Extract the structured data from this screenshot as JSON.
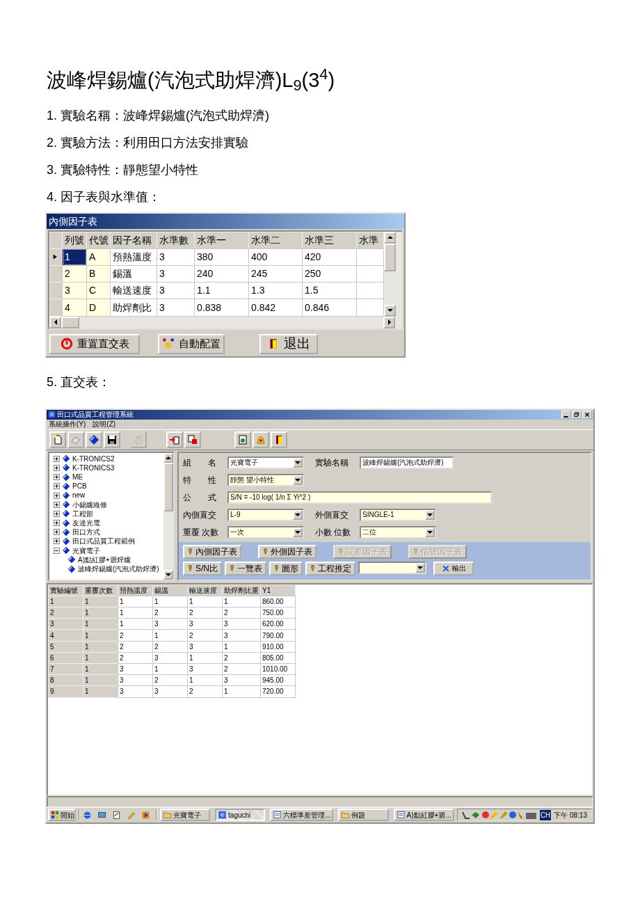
{
  "document": {
    "title": "波峰焊錫爐(汽泡式助焊濟)L$_{9}$(3$^{4}$)",
    "steps": [
      "1. 實驗名稱：波峰焊錫爐(汽泡式助焊濟)",
      "2. 實驗方法：利用田口方法安排實驗",
      "3. 實驗特性：靜態望小特性",
      "4. 因子表與水準值："
    ],
    "step_5": "5. 直交表："
  },
  "factor_dialog": {
    "title": "內側因子表",
    "columns": [
      "列號",
      "代號",
      "因子名稱",
      "水準數",
      "水準一",
      "水準二",
      "水準三",
      "水準"
    ],
    "rows": [
      {
        "selected": true,
        "cells": [
          "1",
          "A",
          "預熱溫度",
          "3",
          "380",
          "400",
          "420",
          ""
        ]
      },
      {
        "selected": false,
        "cells": [
          "2",
          "B",
          "錫溫",
          "3",
          "240",
          "245",
          "250",
          ""
        ]
      },
      {
        "selected": false,
        "cells": [
          "3",
          "C",
          "輸送速度",
          "3",
          "1.1",
          "1.3",
          "1.5",
          ""
        ]
      },
      {
        "selected": false,
        "cells": [
          "4",
          "D",
          "助焊劑比",
          "3",
          "0.838",
          "0.842",
          "0.846",
          ""
        ]
      }
    ],
    "buttons": [
      {
        "kind": "reset",
        "label": "重置直交表"
      },
      {
        "kind": "auto",
        "label": "自動配置"
      },
      {
        "kind": "exit",
        "label": "退出"
      }
    ]
  },
  "app_window": {
    "title": "田口式品質工程管理系統",
    "menu": [
      "系統操作(Y)",
      "說明(Z)"
    ],
    "toolbar_groups": [
      [
        {
          "kind": "page",
          "disabled": false
        },
        {
          "kind": "eraser",
          "disabled": false
        },
        {
          "kind": "book",
          "disabled": false
        },
        {
          "kind": "disk",
          "disabled": false
        }
      ],
      [
        {
          "kind": "hand",
          "disabled": true
        }
      ],
      [
        {
          "kind": "import",
          "disabled": false
        },
        {
          "kind": "export",
          "disabled": false
        }
      ],
      [
        {
          "kind": "report",
          "disabled": false
        },
        {
          "kind": "alarm",
          "disabled": false
        },
        {
          "kind": "door",
          "disabled": false
        }
      ]
    ],
    "tree": [
      {
        "label": "K-TRONICS2",
        "expanded": false
      },
      {
        "label": "K-TRONICS3",
        "expanded": false
      },
      {
        "label": "ME",
        "expanded": false
      },
      {
        "label": "PCB",
        "expanded": false
      },
      {
        "label": "new",
        "expanded": false
      },
      {
        "label": "小錫爐維修",
        "expanded": false
      },
      {
        "label": "工程部",
        "expanded": false
      },
      {
        "label": "友達光電",
        "expanded": false
      },
      {
        "label": "田口方式",
        "expanded": false
      },
      {
        "label": "田口式品質工程範例",
        "expanded": false
      },
      {
        "label": "光寶電子",
        "expanded": true,
        "children": [
          {
            "label": "A)點紅膠+迴焊爐"
          },
          {
            "label": "波峰焊錫爐(汽泡式助焊濟)"
          }
        ]
      }
    ],
    "form_rows": [
      [
        {
          "label": "組　　名",
          "kind": "combo",
          "value": "光寶電子",
          "color": "#ffffff"
        },
        {
          "label": "實驗名稱",
          "kind": "text",
          "value": "波峰焊錫爐(汽泡式助焊濟)",
          "color": "#ffffff"
        }
      ],
      [
        {
          "label": "特　　性",
          "kind": "combo",
          "value": "靜態 望小特性",
          "color": "#ffffe1"
        }
      ],
      [
        {
          "label": "公　　式",
          "kind": "text",
          "value": "S/N = -10 log( 1/n Σ Yi^2 )",
          "color": "#ffffe1"
        }
      ],
      [
        {
          "label": "內側直交",
          "kind": "combo",
          "value": "L-9",
          "color": "#ffffe1"
        },
        {
          "label": "外側直交",
          "kind": "combo",
          "value": "SINGLE-1",
          "color": "#ffffe1"
        }
      ],
      [
        {
          "label": "重覆 次數",
          "kind": "combo",
          "value": "一次",
          "color": "#ffffe1"
        },
        {
          "label": "小數 位數",
          "kind": "combo",
          "value": "二位",
          "color": "#ffffe1"
        }
      ]
    ],
    "action_rows": [
      [
        {
          "kind": "button",
          "label": "內側因子表",
          "disabled": false
        },
        {
          "kind": "button",
          "label": "外側因子表",
          "disabled": false
        },
        {
          "kind": "button",
          "label": "誤差因子表",
          "disabled": true
        },
        {
          "kind": "button",
          "label": "信號因子表",
          "disabled": true
        }
      ],
      [
        {
          "kind": "button",
          "label": "S/N比",
          "disabled": false
        },
        {
          "kind": "button",
          "label": "一覽表",
          "disabled": false
        },
        {
          "kind": "button",
          "label": "圖形",
          "disabled": false
        },
        {
          "kind": "button",
          "label": "工程推定",
          "disabled": false
        },
        {
          "kind": "combo"
        },
        {
          "kind": "export",
          "label": "輸出",
          "disabled": false
        }
      ]
    ],
    "grid": {
      "columns": [
        "實驗編號",
        "重覆次數",
        "預熱溫度",
        "錫溫",
        "輸送速度",
        "助焊劑比重",
        "Y1"
      ],
      "rows": [
        [
          "1",
          "1",
          "1",
          "1",
          "1",
          "1",
          "860.00"
        ],
        [
          "2",
          "1",
          "1",
          "2",
          "2",
          "2",
          "750.00"
        ],
        [
          "3",
          "1",
          "1",
          "3",
          "3",
          "3",
          "620.00"
        ],
        [
          "4",
          "1",
          "2",
          "1",
          "2",
          "3",
          "790.00"
        ],
        [
          "5",
          "1",
          "2",
          "2",
          "3",
          "1",
          "910.00"
        ],
        [
          "6",
          "1",
          "2",
          "3",
          "1",
          "2",
          "805.00"
        ],
        [
          "7",
          "1",
          "3",
          "1",
          "3",
          "2",
          "1010.00"
        ],
        [
          "8",
          "1",
          "3",
          "2",
          "1",
          "3",
          "945.00"
        ],
        [
          "9",
          "1",
          "3",
          "3",
          "2",
          "1",
          "720.00"
        ]
      ]
    }
  },
  "taskbar": {
    "start": "開始",
    "quick_launch": [
      {
        "kind": "globe"
      },
      {
        "kind": "desktop"
      },
      {
        "kind": "notepad"
      },
      {
        "kind": "pen"
      },
      {
        "kind": "media"
      }
    ],
    "tasks": [
      {
        "kind": "folder",
        "label": "光寶電子",
        "selected": false
      },
      {
        "kind": "app",
        "label": "taguchi",
        "selected": true
      },
      {
        "kind": "doc",
        "label": "六標準差管理...",
        "selected": false
      },
      {
        "kind": "folder",
        "label": "例題",
        "selected": false
      },
      {
        "kind": "doc",
        "label": "A)點紅膠+迴...",
        "selected": false
      }
    ],
    "language": "CH",
    "time": "下午 08:13"
  }
}
